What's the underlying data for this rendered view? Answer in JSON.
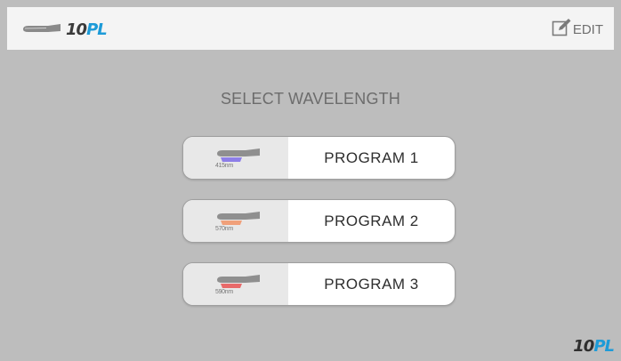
{
  "header": {
    "logo_num": "10",
    "logo_acc": "PL",
    "edit_label": "EDIT"
  },
  "title": "SELECT WAVELENGTH",
  "programs": [
    {
      "label": "PROGRAM 1",
      "wavelength": "415nm",
      "color": "#8d7ee8"
    },
    {
      "label": "PROGRAM 2",
      "wavelength": "570nm",
      "color": "#f0a07a"
    },
    {
      "label": "PROGRAM 3",
      "wavelength": "590nm",
      "color": "#e86a6a"
    }
  ],
  "footer": {
    "logo_num": "10",
    "logo_acc": "PL"
  },
  "colors": {
    "background": "#bdbdbd",
    "header": "#f4f4f4",
    "accent": "#1d9bd8"
  }
}
